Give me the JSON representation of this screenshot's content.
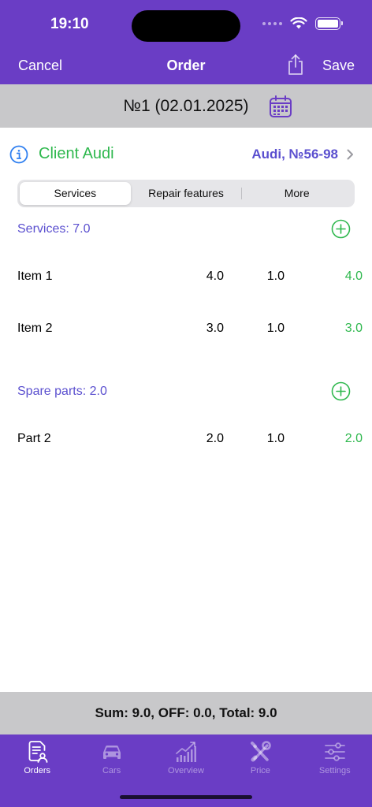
{
  "status": {
    "time": "19:10"
  },
  "nav": {
    "cancel": "Cancel",
    "title": "Order",
    "save": "Save"
  },
  "order": {
    "title": "№1 (02.01.2025)"
  },
  "client": {
    "name": "Client Audi",
    "car": "Audi, №56-98"
  },
  "segments": [
    {
      "label": "Services",
      "active": true
    },
    {
      "label": "Repair features",
      "active": false
    },
    {
      "label": "More",
      "active": false
    }
  ],
  "services": {
    "header": "Services: 7.0",
    "items": [
      {
        "name": "Item 1",
        "price": "4.0",
        "qty": "1.0",
        "total": "4.0"
      },
      {
        "name": "Item 2",
        "price": "3.0",
        "qty": "1.0",
        "total": "3.0"
      }
    ]
  },
  "parts": {
    "header": "Spare parts: 2.0",
    "items": [
      {
        "name": "Part 2",
        "price": "2.0",
        "qty": "1.0",
        "total": "2.0"
      }
    ]
  },
  "summary": {
    "text": "Sum: 9.0, OFF: 0.0, Total: 9.0"
  },
  "tabs": [
    {
      "label": "Orders",
      "icon": "orders-icon",
      "active": true
    },
    {
      "label": "Cars",
      "icon": "car-icon",
      "active": false
    },
    {
      "label": "Overview",
      "icon": "chart-icon",
      "active": false
    },
    {
      "label": "Price",
      "icon": "tools-icon",
      "active": false
    },
    {
      "label": "Settings",
      "icon": "sliders-icon",
      "active": false
    }
  ],
  "colors": {
    "brand": "#6a3dc5",
    "accent_green": "#2fb84e",
    "accent_indigo": "#5a4fcf",
    "bar_gray": "#c8c8ca"
  }
}
